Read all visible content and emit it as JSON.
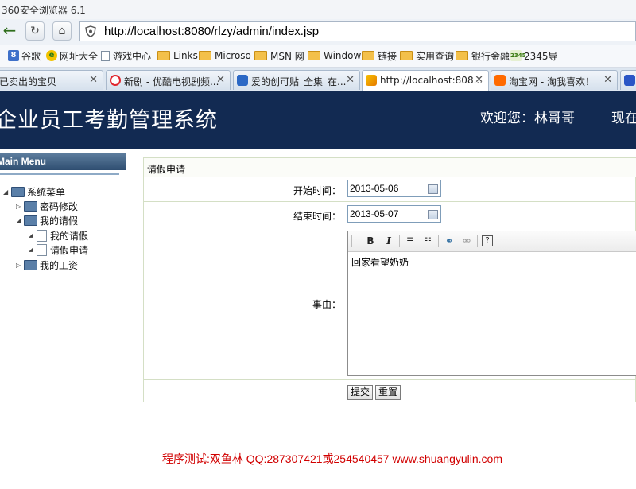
{
  "browser": {
    "window_title": "360安全浏览器 6.1",
    "url": "http://localhost:8080/rlzy/admin/index.jsp",
    "bookmarks": [
      "谷歌",
      "网址大全",
      "游戏中心",
      "Links",
      "Microso",
      "MSN 网",
      "Window",
      "链接",
      "实用查询",
      "银行金融",
      "2345导"
    ],
    "tabs": [
      "已卖出的宝贝",
      "新剧 - 优酷电视剧频...",
      "爱的创可贴_全集_在...",
      "http://localhost:808...",
      "淘宝网 - 淘我喜欢！"
    ],
    "active_tab_index": 3
  },
  "app": {
    "title": "企业员工考勤管理系统",
    "welcome": "欢迎您：林哥哥",
    "now_label": "现在"
  },
  "sidebar": {
    "header": "Main Menu",
    "root": "系统菜单",
    "items": [
      {
        "label": "密码修改"
      },
      {
        "label": "我的请假",
        "children": [
          "我的请假",
          "请假申请"
        ]
      },
      {
        "label": "我的工资"
      }
    ]
  },
  "form": {
    "title": "请假申请",
    "start_label": "开始时间：",
    "start_value": "2013-05-06",
    "end_label": "结束时间：",
    "end_value": "2013-05-07",
    "reason_label": "事由：",
    "reason_value": "回家看望奶奶",
    "submit": "提交",
    "reset": "重置"
  },
  "footer": "程序测试:双鱼林 QQ:287307421或254540457 www.shuangyulin.com",
  "colors": {
    "header_bg": "#122a52",
    "footer_text": "#d10000"
  }
}
